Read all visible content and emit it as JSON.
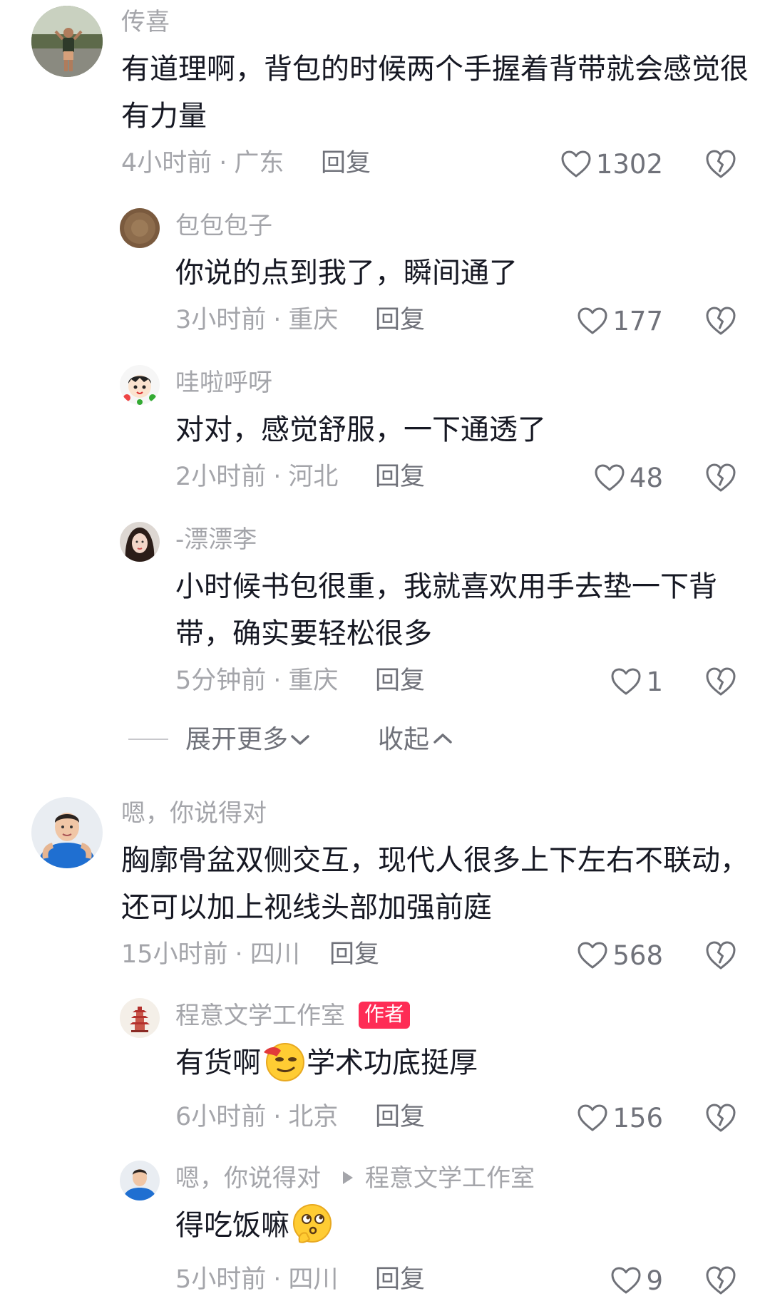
{
  "colors": {
    "background": "#ffffff",
    "text_primary": "#161823",
    "text_secondary": "#a4a5aa",
    "text_action": "#70727a",
    "author_badge": "#fe2c55"
  },
  "icons": {
    "like": "heart-outline-icon",
    "dislike": "broken-heart-icon",
    "expand": "chevron-down-icon",
    "collapse": "chevron-up-icon",
    "reply_to": "triangle-right-icon"
  },
  "comments": [
    {
      "username": "传喜",
      "text": "有道理啊，背包的时候两个手握着背带就会感觉很有力量",
      "time": "4小时前",
      "location": "广东",
      "reply_label": "回复",
      "likes": "1302",
      "replies": [
        {
          "username": "包包包子",
          "text": "你说的点到我了，瞬间通了",
          "time": "3小时前",
          "location": "重庆",
          "reply_label": "回复",
          "likes": "177"
        },
        {
          "username": "哇啦呼呀",
          "text": "对对，感觉舒服，一下通透了",
          "time": "2小时前",
          "location": "河北",
          "reply_label": "回复",
          "likes": "48"
        },
        {
          "username": "-漂漂李",
          "text": "小时候书包很重，我就喜欢用手去垫一下背带，确实要轻松很多",
          "time": "5分钟前",
          "location": "重庆",
          "reply_label": "回复",
          "likes": "1"
        }
      ],
      "expand_label": "展开更多",
      "collapse_label": "收起"
    },
    {
      "username": "嗯，你说得对",
      "text": "胸廓骨盆双侧交互，现代人很多上下左右不联动，还可以加上视线头部加强前庭",
      "time": "15小时前",
      "location": "四川",
      "reply_label": "回复",
      "likes": "568",
      "replies": [
        {
          "username": "程意文学工作室",
          "badge": "作者",
          "text_before": "有货啊",
          "emoji": "smug-face-emoji",
          "text_after": "学术功底挺厚",
          "time": "6小时前",
          "location": "北京",
          "reply_label": "回复",
          "likes": "156"
        },
        {
          "username": "嗯，你说得对",
          "reply_to": "程意文学工作室",
          "text_before": "得吃饭嘛",
          "emoji": "thinking-face-emoji",
          "time": "5小时前",
          "location": "四川",
          "reply_label": "回复",
          "likes": "9"
        }
      ]
    }
  ]
}
